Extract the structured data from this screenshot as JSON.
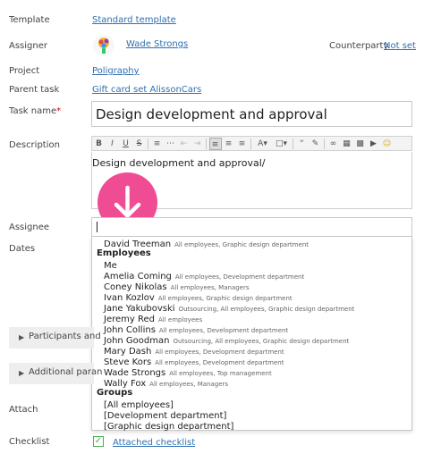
{
  "labels": {
    "template": "Template",
    "assigner": "Assigner",
    "project": "Project",
    "parent_task": "Parent task",
    "task_name": "Task name",
    "task_name_required": "*",
    "description": "Description",
    "assignee": "Assignee",
    "dates": "Dates",
    "attach": "Attach",
    "checklist": "Checklist",
    "counterparty": "Counterparty"
  },
  "values": {
    "template": "Standard template",
    "assigner": "Wade Strongs",
    "counterparty": "Not set",
    "project": "Poligraphy",
    "parent_task": "Gift card set AlissonCars",
    "task_name": "Design development and approval",
    "description_text": "Design development and approval/",
    "checklist": "Attached checklist"
  },
  "panels": {
    "participants": "Participants and",
    "additional": "Additional paran"
  },
  "dropdown": {
    "top_item": {
      "name": "David Treeman",
      "sub": "All employees, Graphic design department"
    },
    "employees_header": "Employees",
    "employees": [
      {
        "name": "Me",
        "sub": ""
      },
      {
        "name": "Amelia Coming",
        "sub": "All employees, Development department"
      },
      {
        "name": "Coney Nikolas",
        "sub": "All employees, Managers"
      },
      {
        "name": "Ivan Kozlov",
        "sub": "All employees, Graphic design department"
      },
      {
        "name": "Jane Yakubovski",
        "sub": "Outsourcing, All employees, Graphic design department"
      },
      {
        "name": "Jeremy Red",
        "sub": "All employees"
      },
      {
        "name": "John Collins",
        "sub": "All employees, Development department"
      },
      {
        "name": "John Goodman",
        "sub": "Outsourcing, All employees, Graphic design department"
      },
      {
        "name": "Mary Dash",
        "sub": "All employees, Development department"
      },
      {
        "name": "Steve Kors",
        "sub": "All employees, Development department"
      },
      {
        "name": "Wade Strongs",
        "sub": "All employees, Top management"
      },
      {
        "name": "Wally Fox",
        "sub": "All employees, Managers"
      }
    ],
    "groups_header": "Groups",
    "groups": [
      "[All employees]",
      "[Development department]",
      "[Graphic design department]"
    ]
  },
  "toolbar_icons": [
    "bold-icon",
    "italic-icon",
    "underline-icon",
    "strikethrough-icon",
    "numbered-list-icon",
    "bulleted-list-icon",
    "outdent-icon",
    "indent-icon",
    "align-left-icon",
    "align-center-icon",
    "align-right-icon",
    "text-color-icon",
    "background-color-icon",
    "quote-icon",
    "remove-format-icon",
    "link-icon",
    "table-icon",
    "image-icon",
    "video-icon",
    "emoji-icon"
  ],
  "colors": {
    "link": "#2f6fb3",
    "accent_fab": "#ef4c93",
    "checkbox": "#4caf50"
  }
}
